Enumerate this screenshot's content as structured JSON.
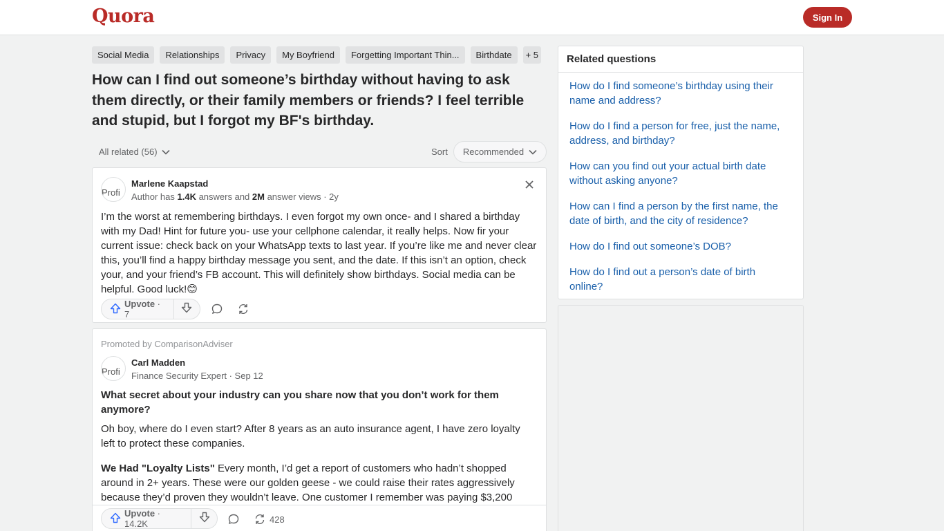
{
  "header": {
    "logo": "Quora",
    "sign_in": "Sign In"
  },
  "topics": [
    "Social Media",
    "Relationships",
    "Privacy",
    "My Boyfriend",
    "Forgetting Important Thin...",
    "Birthdate",
    "+ 5"
  ],
  "question": "How can I find out someone’s birthday without having to ask them directly, or their family members or friends? I feel terrible and stupid, but I forgot my BF's birthday.",
  "filter": {
    "all_related": "All related (56)",
    "sort_label": "Sort",
    "sort_value": "Recommended"
  },
  "answer": {
    "avatar_alt": "Profi",
    "author": "Marlene Kaapstad",
    "cred_prefix": "Author has ",
    "answers_count": "1.4K",
    "cred_mid": " answers and ",
    "views_count": "2M",
    "cred_suffix": " answer views · 2y",
    "text": "I’m the worst at remembering birthdays. I even forgot my own once- and I shared a birthday with my Dad! Hint for future you- use your cellphone calendar, it really helps. Now fir your current issue: check back on your WhatsApp texts to last year. If you’re like me and never clear this, you’ll find a happy birthday message you sent, and the date. If this isn’t an option, check your, and your friend’s FB account. This will definitely show birthdays. Social media can be helpful. Good luck!",
    "emoji": "😊",
    "upvote_label": "Upvote",
    "upvote_count": " · 7"
  },
  "promoted": {
    "promo_text": "Promoted by ComparisonAdviser",
    "avatar_alt": "Profi",
    "author": "Carl Madden",
    "cred": "Finance Security Expert · Sep 12",
    "title": "What secret about your industry can you share now that you don’t work for them anymore?",
    "para1": "Oh boy, where do I even start? After 8 years as an auto insurance agent, I have zero loyalty left to protect these companies.",
    "para2_bold": "We Had \"Loyalty Lists\"",
    "para2": " Every month, I’d get a report of customers who hadn’t shopped around in 2+ years. These were our golden geese - we could raise their rates aggressively because they’d proven they wouldn’t leave. One customer I remember was paying $3,200",
    "upvote_label": "Upvote",
    "upvote_count": " · 14.2K",
    "share_count": "428"
  },
  "related": {
    "title": "Related questions",
    "items": [
      "How do I find someone’s birthday using their name and address?",
      "How do I find a person for free, just the name, address, and birthday?",
      "How can you find out your actual birth date without asking anyone?",
      "How can I find a person by the first name, the date of birth, and the city of residence?",
      "How do I find out someone’s DOB?",
      "How do I find out a person’s date of birth online?"
    ]
  },
  "colors": {
    "brand": "#b92b27",
    "link": "#195faa",
    "upvote": "#2e69ff",
    "background": "#f1f2f2"
  }
}
